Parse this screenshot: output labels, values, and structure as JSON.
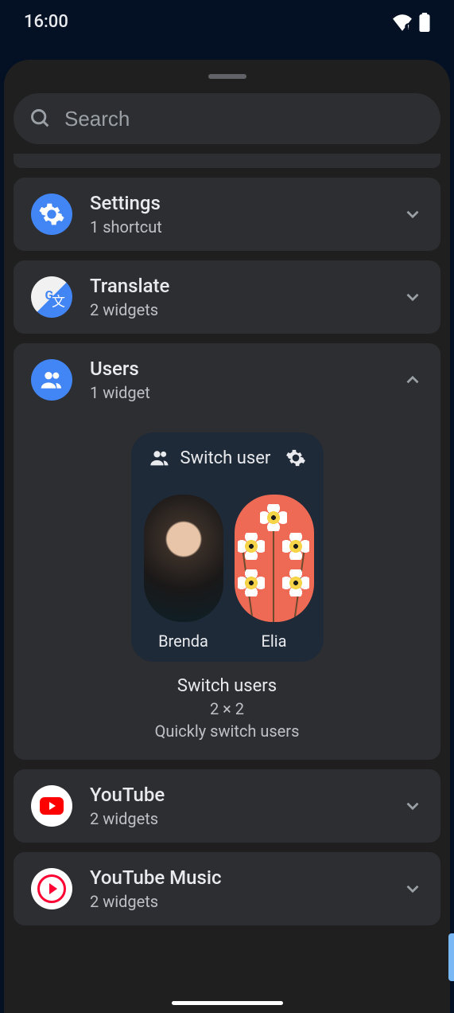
{
  "statusbar": {
    "time": "16:00"
  },
  "search": {
    "placeholder": "Search"
  },
  "apps": {
    "settings": {
      "name": "Settings",
      "sub": "1 shortcut"
    },
    "translate": {
      "name": "Translate",
      "sub": "2 widgets"
    },
    "users": {
      "name": "Users",
      "sub": "1 widget"
    },
    "youtube": {
      "name": "YouTube",
      "sub": "2 widgets"
    },
    "ytmusic": {
      "name": "YouTube Music",
      "sub": "2 widgets"
    }
  },
  "widget": {
    "header": "Switch user",
    "users": [
      {
        "name": "Brenda"
      },
      {
        "name": "Elia"
      }
    ],
    "meta": {
      "title": "Switch users",
      "size": "2 × 2",
      "desc": "Quickly switch users"
    }
  }
}
